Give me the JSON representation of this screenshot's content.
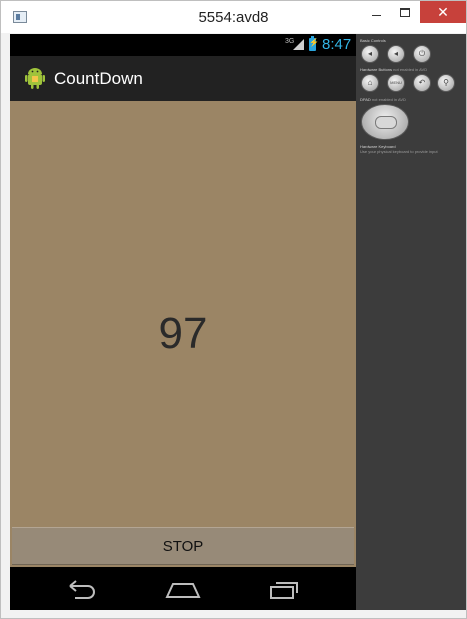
{
  "window": {
    "title": "5554:avd8",
    "minimize_icon": "minimize-icon",
    "maximize_icon": "maximize-icon",
    "close_label": "✕"
  },
  "status_bar": {
    "network": "3G",
    "time": "8:47"
  },
  "action_bar": {
    "app_title": "CountDown"
  },
  "main": {
    "counter": "97",
    "stop_label": "STOP"
  },
  "nav_bar": {
    "back_icon": "back-icon",
    "home_icon": "home-icon",
    "recent_icon": "recent-apps-icon"
  },
  "controls": {
    "basic_controls_label": "Basic Controls",
    "hardware_buttons_label": "Hardware Buttons",
    "hardware_buttons_note": "not enabled in AVD",
    "dpad_label": "DPAD",
    "dpad_note": "not enabled in AVD",
    "keyboard_label": "Hardware Keyboard",
    "keyboard_note": "Use your physical keyboard to provide input",
    "menu_label": "MENU"
  },
  "colors": {
    "content_bg": "#9b8565",
    "action_bar_bg": "#222222",
    "clock": "#33b5e5",
    "close_button": "#c7413b"
  }
}
